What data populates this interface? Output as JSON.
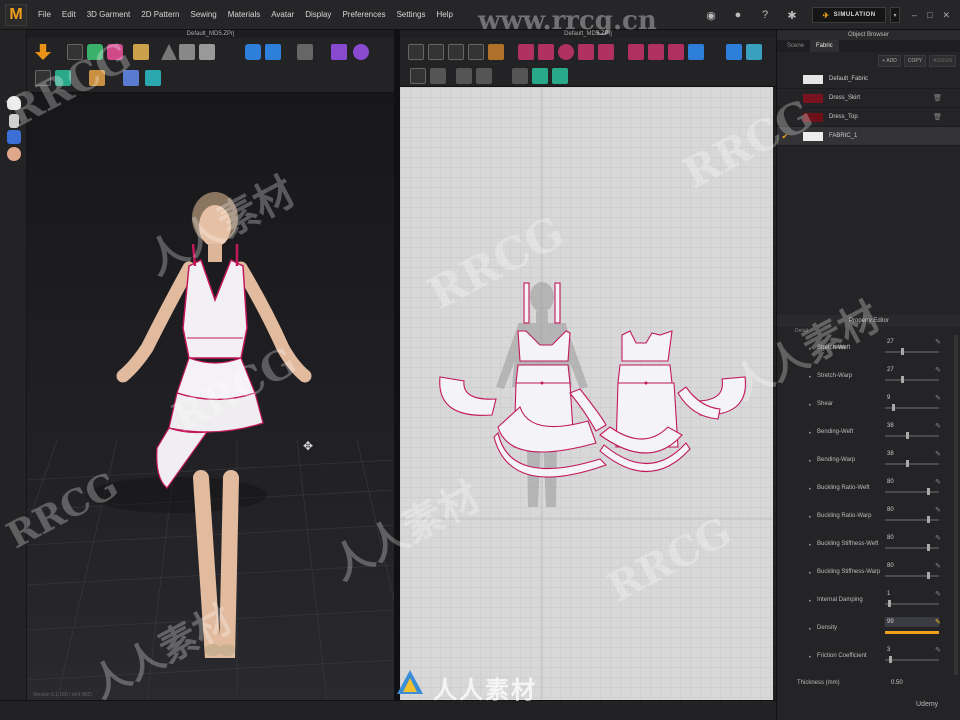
{
  "app": {
    "logo_letter": "M",
    "menu": [
      "File",
      "Edit",
      "3D Garment",
      "2D Pattern",
      "Sewing",
      "Materials",
      "Avatar",
      "Display",
      "Preferences",
      "Settings",
      "Help"
    ],
    "simulation_label": "SIMULATION",
    "window_controls": [
      "–",
      "□",
      "✕"
    ]
  },
  "window3d": {
    "title": "Default_MD5.ZPrj",
    "footer": "Version 5.1.160 / x64 (MZ)"
  },
  "window2d": {
    "title": "Default_MD5.ZPrj"
  },
  "object_browser": {
    "title": "Object Browser",
    "tabs": [
      "Scene",
      "Fabric"
    ],
    "active_tab": "Fabric",
    "actions": {
      "add": "+ ADD",
      "copy": "COPY",
      "assign": "ASSIGN"
    },
    "fabrics": [
      {
        "name": "Default_Fabric",
        "swatch": "#e6e6e6",
        "selected": false,
        "deletable": false
      },
      {
        "name": "Dress_Skirt",
        "swatch": "#7a1220",
        "selected": false,
        "deletable": true
      },
      {
        "name": "Dress_Top",
        "swatch": "#6e1018",
        "selected": false,
        "deletable": true
      },
      {
        "name": "FABRIC_1",
        "swatch": "#eeeeee",
        "selected": true,
        "deletable": false
      }
    ]
  },
  "property_editor": {
    "title": "Property Editor",
    "section": "Detail",
    "properties": [
      {
        "label": "Stretch-Weft",
        "value": "27"
      },
      {
        "label": "Stretch-Warp",
        "value": "27"
      },
      {
        "label": "Shear",
        "value": "9"
      },
      {
        "label": "Bending-Weft",
        "value": "38"
      },
      {
        "label": "Bending-Warp",
        "value": "38"
      },
      {
        "label": "Buckling Ratio-Weft",
        "value": "80"
      },
      {
        "label": "Buckling Ratio-Warp",
        "value": "80"
      },
      {
        "label": "Buckling Stiffness-Weft",
        "value": "80"
      },
      {
        "label": "Buckling Stiffness-Warp",
        "value": "80"
      },
      {
        "label": "Internal Damping",
        "value": "1"
      },
      {
        "label": "Density",
        "value": "99"
      },
      {
        "label": "Friction Coefficient",
        "value": "3"
      }
    ],
    "thickness": {
      "label": "Thickness (mm)",
      "value": "0.50"
    }
  },
  "watermarks": {
    "top": "www.rrcg.cn",
    "latin": "RRCG",
    "cjk": "人人素材",
    "brand": "人人素材"
  },
  "footer": {
    "udemy": "Udemy"
  },
  "colors": {
    "accent": "#f0a01a",
    "seam": "#c2185b",
    "background": "#1b1b1d",
    "pattern_canvas": "#d8d8d8"
  }
}
